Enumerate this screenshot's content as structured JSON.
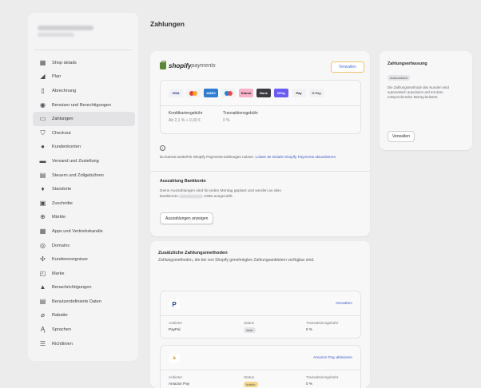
{
  "sidebar": {
    "items": [
      {
        "label": "Shop details",
        "icon": "store-icon"
      },
      {
        "label": "Plan",
        "icon": "plan-icon"
      },
      {
        "label": "Abrechnung",
        "icon": "billing-icon"
      },
      {
        "label": "Benutzer und Berechtigungen",
        "icon": "users-icon"
      },
      {
        "label": "Zahlungen",
        "icon": "payments-icon",
        "active": true
      },
      {
        "label": "Checkout",
        "icon": "checkout-icon"
      },
      {
        "label": "Kundenkonten",
        "icon": "customer-icon"
      },
      {
        "label": "Versand und Zustellung",
        "icon": "shipping-icon"
      },
      {
        "label": "Steuern und Zollgebühren",
        "icon": "taxes-icon"
      },
      {
        "label": "Standorte",
        "icon": "location-icon"
      },
      {
        "label": "Zuschnitte",
        "icon": "gift-icon"
      },
      {
        "label": "Märkte",
        "icon": "markets-icon"
      },
      {
        "label": "Apps und Vertriebskanäle",
        "icon": "apps-icon"
      },
      {
        "label": "Domains",
        "icon": "domains-icon"
      },
      {
        "label": "Kundenereignisse",
        "icon": "events-icon"
      },
      {
        "label": "Marke",
        "icon": "brand-icon"
      },
      {
        "label": "Benachrichtigungen",
        "icon": "bell-icon"
      },
      {
        "label": "Benutzerdefinierte Daten",
        "icon": "data-icon"
      },
      {
        "label": "Rabatte",
        "icon": "discount-icon"
      },
      {
        "label": "Sprachen",
        "icon": "language-icon"
      },
      {
        "label": "Richtlinien",
        "icon": "policy-icon"
      }
    ]
  },
  "main": {
    "title": "Zahlungen",
    "shopify_payments": {
      "brand": "shopify",
      "brand_suffix": "payments",
      "manage_label": "Verwalten",
      "methods": [
        "VISA",
        "",
        "AMEX",
        "",
        "Klarna",
        "Bank",
        "GPay",
        "Pay",
        "G Pay"
      ],
      "fee_label_1": "Kreditkartengebühr",
      "fee_value_1": "Ab 2,1 % + 0,30 €",
      "fee_label_2": "Transaktionsgebühr",
      "fee_value_2": "0 %",
      "info_text": "Du kannst weiterhin Shopify Payments-Zahlungen nutzen. ",
      "info_link": "Lokale de Details Shopify Payments aktualisieren",
      "payout_title": "Auszahlung Bankkonto",
      "payout_text_1": "Deine Auszahlungen sind für jeden Montag geplant und werden an dein",
      "payout_text_2": "Bankkonto",
      "payout_text_3": "2396 ausgezahlt.",
      "payout_button": "Auszahlungen anzeigen"
    },
    "side_card": {
      "title": "Zahlungserfassung",
      "badge": "Automatisch",
      "text": "Die Zahlungsmethode des Kunden wird automatisch autorisiert und mit dem entsprechenden Betrag belastet.",
      "button": "Verwalten"
    },
    "additional": {
      "title": "Zusätzliche Zahlungsmethoden",
      "subtitle": "Zahlungsmethoden, die bei von Shopify genehmigten Zahlungsanbietern verfügbar sind.",
      "methods": [
        {
          "action": "Verwalten",
          "col1_h": "Anbieter",
          "col1_v": "PayPal",
          "col2_h": "Status",
          "col2_v": "Aktiv",
          "col3_h": "Transaktionsgebühr",
          "col3_v": "0 %"
        },
        {
          "action": "Amazon Pay aktivieren",
          "col1_h": "Anbieter",
          "col1_v": "Amazon Pay",
          "col2_h": "Status",
          "col2_v": "Inaktiv",
          "col3_h": "Transaktionsgebühr",
          "col3_v": "0 %"
        }
      ]
    }
  }
}
